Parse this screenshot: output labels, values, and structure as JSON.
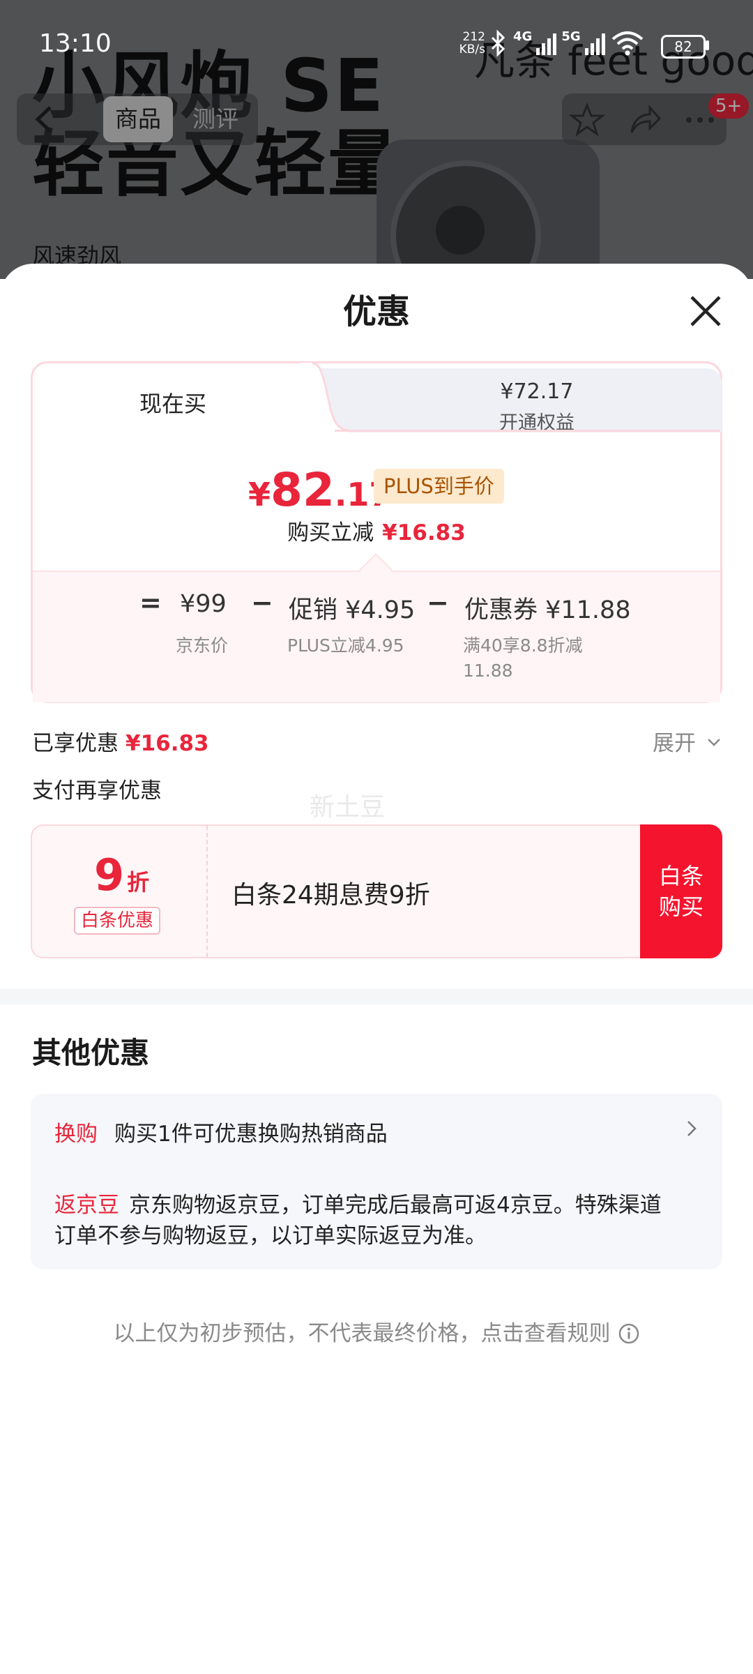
{
  "status_bar": {
    "time": "13:10",
    "net_speed": "212",
    "net_unit": "KB/s",
    "signal_1": "4G",
    "signal_2": "5G",
    "battery": "82"
  },
  "product_bg": {
    "hero_line1": "小风炮 SE",
    "hero_line2": "轻音又轻量",
    "sub": "风速劲风",
    "brand": "凡条  feet good",
    "tab_active": "商品",
    "tab_idle": "测评",
    "cart_badge": "5+"
  },
  "sheet": {
    "title": "优惠"
  },
  "price_tabs": {
    "buy_now": "现在买",
    "plus_price": "¥72.17",
    "plus_label": "开通权益"
  },
  "price": {
    "currency": "¥",
    "integer": "82",
    "decimal": ".17",
    "tag": "PLUS到手价",
    "reduce_label": "购买立减",
    "reduce_value": "¥16.83"
  },
  "formula": {
    "equals": "=",
    "minus": "−",
    "base_value": "¥99",
    "base_label": "京东价",
    "promo_value": "促销 ¥4.95",
    "promo_label": "PLUS立减4.95",
    "coupon_value": "优惠券 ¥11.88",
    "coupon_label_1": "满40享8.8折减",
    "coupon_label_2": "11.88"
  },
  "enjoyed": {
    "label": "已享优惠",
    "value": "¥16.83",
    "expand": "展开"
  },
  "payment": {
    "title": "支付再享优惠",
    "watermark": "新土豆",
    "discount_num": "9",
    "discount_unit": "折",
    "tag": "白条优惠",
    "desc": "白条24期息费9折",
    "button_line1": "白条",
    "button_line2": "购买"
  },
  "other": {
    "title": "其他优惠",
    "swap_tag": "换购",
    "swap_text": "购买1件可优惠换购热销商品",
    "bean_tag": "返京豆",
    "bean_text": "京东购物返京豆，订单完成后最高可返4京豆。特殊渠道订单不参与购物返豆，以订单实际返豆为准。"
  },
  "disclaimer": "以上仅为初步预估，不代表最终价格，点击查看规则"
}
